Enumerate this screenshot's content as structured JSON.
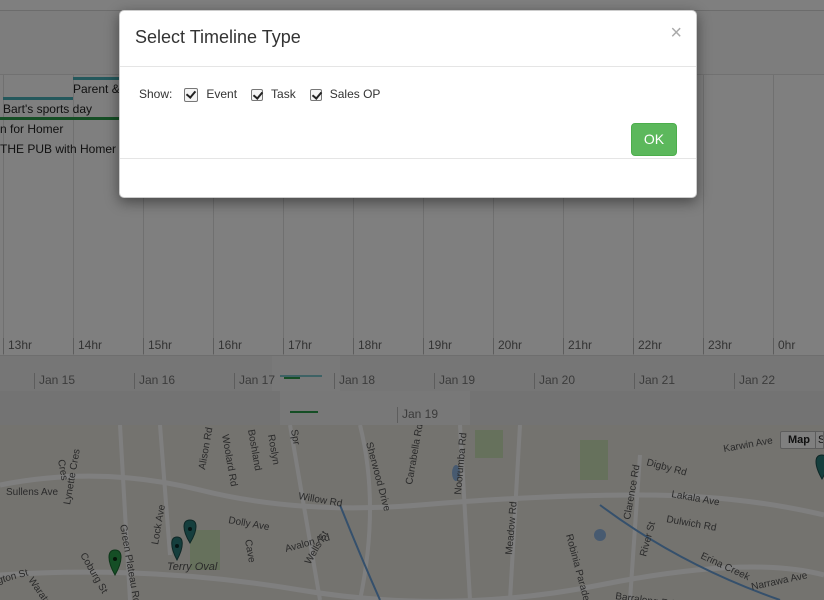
{
  "modal": {
    "title": "Select Timeline Type",
    "close_glyph": "×",
    "show_label": "Show:",
    "options": [
      {
        "label": "Event",
        "checked": true
      },
      {
        "label": "Task",
        "checked": true
      },
      {
        "label": "Sales OP",
        "checked": true
      }
    ],
    "ok_label": "OK"
  },
  "timeline": {
    "events": [
      {
        "text": "Parent &",
        "color": "#48b0b8"
      },
      {
        "text": "Bart's sports day",
        "color": "#48b0b8"
      },
      {
        "text": "n for Homer",
        "color": "#2a9d4a"
      },
      {
        "text": "THE PUB with Homer S",
        "color": "#2a9d4a"
      }
    ],
    "hours": [
      "13hr",
      "14hr",
      "15hr",
      "16hr",
      "17hr",
      "18hr",
      "19hr",
      "20hr",
      "21hr",
      "22hr",
      "23hr",
      "0hr"
    ],
    "dates": [
      "Jan 15",
      "Jan 16",
      "Jan 17",
      "Jan 18",
      "Jan 19",
      "Jan 20",
      "Jan 21",
      "Jan 22"
    ],
    "overview_date": "Jan 19"
  },
  "map": {
    "map_button": "Map",
    "sat_button": "S",
    "labels": [
      "Sullens Ave",
      "Lynette Cres",
      "Green Plateau Rd",
      "Alison Rd",
      "Woolard Rd",
      "Boshland",
      "Roslyn",
      "Spr",
      "Sherwood Drive",
      "Carrabella Rd",
      "Noorumba Rd",
      "Meadow Rd",
      "Robinia Parade",
      "Clarence Rd",
      "Digby Rd",
      "Karwin Ave",
      "Lakala Ave",
      "Dulwich Rd",
      "River St",
      "Erina Creek",
      "Narrawa Ave",
      "Willow Rd",
      "Dolly Ave",
      "Avalon Rd",
      "Wells St",
      "Lock Ave",
      "Terry Oval",
      "Coburg St",
      "Waratah St",
      "Barralong Rd",
      "gton St",
      "Cres",
      "Cave"
    ]
  }
}
